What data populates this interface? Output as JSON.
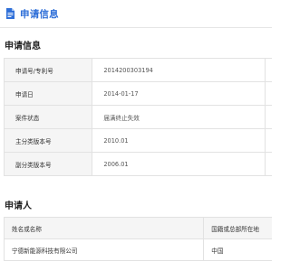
{
  "header": {
    "title": "申请信息",
    "icon": "document-icon",
    "accent_color": "#2f6fd8"
  },
  "application_info": {
    "section_title": "申请信息",
    "rows": [
      {
        "label": "申请号/专利号",
        "value": "2014200303194"
      },
      {
        "label": "申请日",
        "value": "2014-01-17"
      },
      {
        "label": "案件状态",
        "value": "届满终止失效"
      },
      {
        "label": "主分类版本号",
        "value": "2010.01"
      },
      {
        "label": "副分类版本号",
        "value": "2006.01"
      }
    ]
  },
  "applicants": {
    "section_title": "申请人",
    "columns": [
      "姓名或名称",
      "国籍或总部所在地"
    ],
    "rows": [
      {
        "name": "宁德新能源科技有限公司",
        "country": "中国"
      }
    ]
  }
}
